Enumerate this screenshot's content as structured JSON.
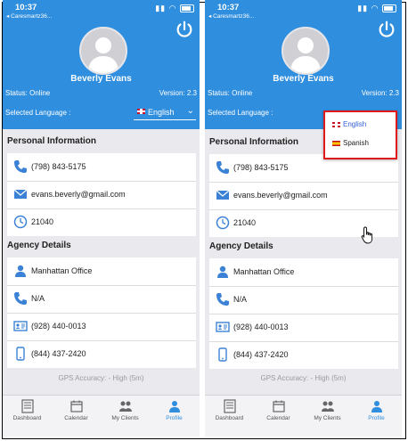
{
  "screens": [
    {
      "id": "left",
      "status_bar": {
        "time": "10:37",
        "back_label": "◂ Caresmartz36..."
      },
      "profile": {
        "name": "Beverly Evans",
        "status": "Status: Online",
        "version": "Version: 2.3"
      },
      "language": {
        "label": "Selected Language :",
        "selected": "English"
      },
      "personal_info": {
        "title": "Personal Information",
        "phone": "(798) 843-5175",
        "email": "evans.beverly@gmail.com",
        "zip": "21040"
      },
      "agency": {
        "title": "Agency Details",
        "office": "Manhattan Office",
        "phone": "N/A",
        "fax": "(928) 440-0013",
        "mobile": "(844) 437-2420"
      },
      "gps": "GPS Accuracy: - High (5m)"
    },
    {
      "id": "right",
      "status_bar": {
        "time": "10:37",
        "back_label": "◂ Caresmartz36..."
      },
      "profile": {
        "name": "Beverly Evans",
        "status": "Status: Online",
        "version": "Version: 2.3"
      },
      "language": {
        "label": "Selected Language :",
        "options": [
          "English",
          "Spanish"
        ]
      },
      "personal_info": {
        "title": "Personal Information",
        "phone": "(798) 843-5175",
        "email": "evans.beverly@gmail.com",
        "zip": "21040"
      },
      "agency": {
        "title": "Agency Details",
        "office": "Manhattan Office",
        "phone": "N/A",
        "fax": "(928) 440-0013",
        "mobile": "(844) 437-2420"
      },
      "gps": "GPS Accuracy: - High (5m)"
    }
  ],
  "tabbar": {
    "tabs": [
      {
        "label": "Dashboard",
        "icon": "dashboard-icon"
      },
      {
        "label": "Calendar",
        "icon": "calendar-icon"
      },
      {
        "label": "My Clients",
        "icon": "clients-icon"
      },
      {
        "label": "Profile",
        "icon": "profile-icon"
      }
    ],
    "active": "Profile"
  },
  "colors": {
    "header": "#2f8ede",
    "accent": "#3b82d6",
    "highlight_border": "#e01a1a",
    "background": "#e9e9ee"
  }
}
